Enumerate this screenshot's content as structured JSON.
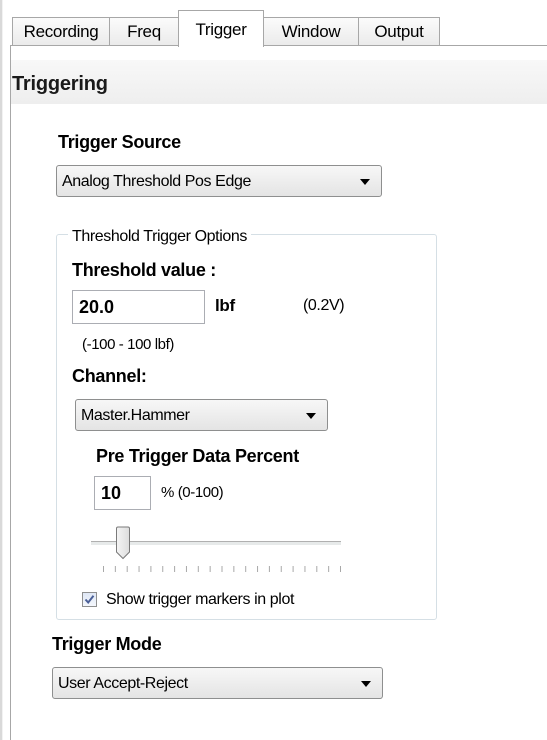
{
  "tabs": [
    "Recording",
    "Freq",
    "Trigger",
    "Window",
    "Output"
  ],
  "active_tab": "Trigger",
  "section_title": "Triggering",
  "trigger_source": {
    "label": "Trigger Source",
    "selected": "Analog Threshold Pos Edge"
  },
  "threshold_group": {
    "title": "Threshold Trigger Options",
    "threshold_label": "Threshold value :",
    "threshold_value": "20.0",
    "unit": "lbf",
    "voltage": "(0.2V)",
    "range": "(-100 - 100 lbf)",
    "channel_label": "Channel:",
    "channel_selected": "Master.Hammer",
    "pre_trigger_label": "Pre Trigger Data Percent",
    "pre_trigger_value": "10",
    "pre_trigger_range": "% (0-100)",
    "pre_trigger_slider_percent": 10,
    "show_markers_label": "Show trigger markers in plot",
    "show_markers_checked": true
  },
  "trigger_mode": {
    "label": "Trigger Mode",
    "selected": "User Accept-Reject"
  },
  "icons": {
    "dropdown": "chevron-down-icon",
    "checkmark": "checkmark-icon"
  },
  "colors": {
    "tab_border": "#a7a7a7",
    "group_border": "#d5dfe5",
    "checkmark": "#4a5f97"
  }
}
